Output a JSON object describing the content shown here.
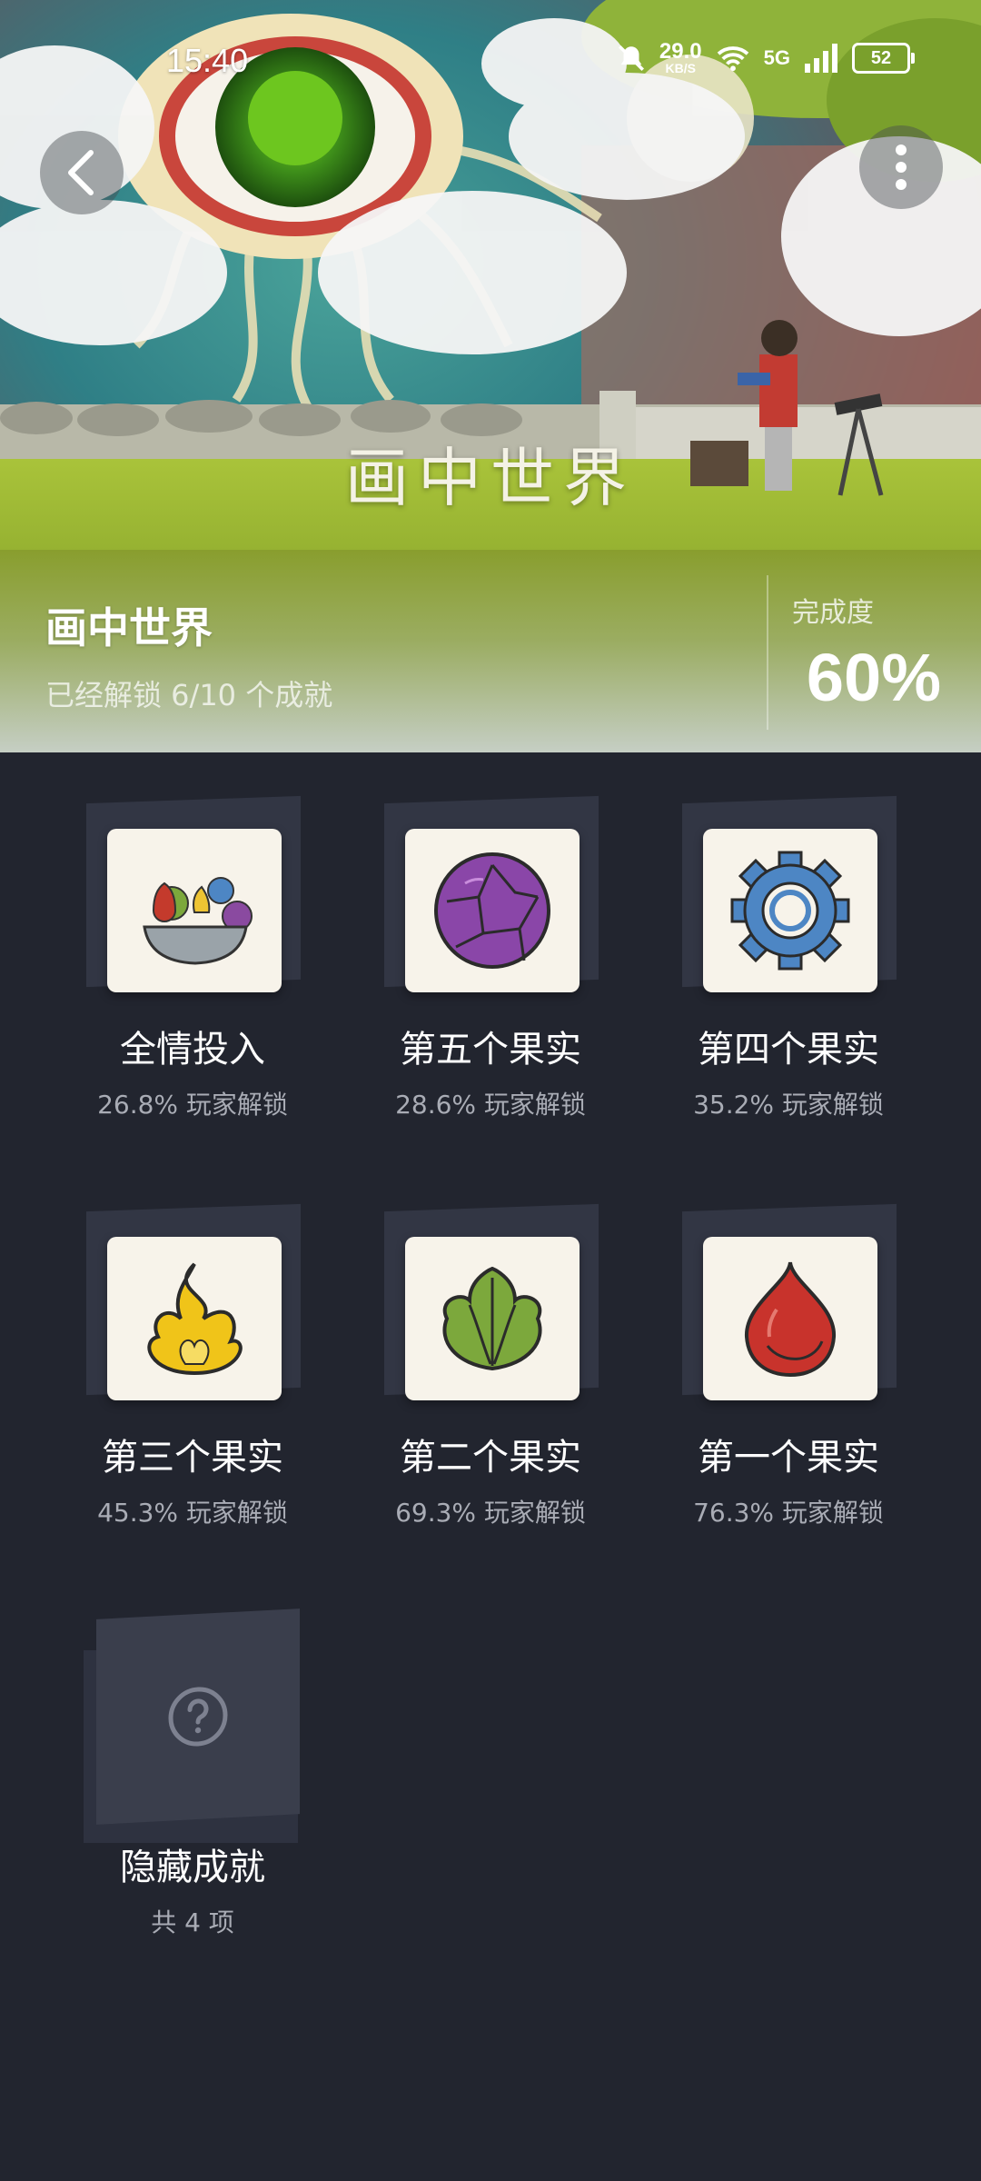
{
  "status_bar": {
    "time": "15:40",
    "speed_value": "29.0",
    "speed_unit": "KB/S",
    "network": "5G",
    "battery": "52"
  },
  "hero": {
    "art_title": "画中世界",
    "back_icon": "chevron-left-icon",
    "more_icon": "more-vertical-icon"
  },
  "game": {
    "name": "画中世界",
    "unlock_summary": "已经解锁 6/10 个成就",
    "completion_label": "完成度",
    "completion_value": "60%",
    "completion_fraction": 0.6
  },
  "achievements": [
    {
      "name": "全情投入",
      "percent": "26.8% 玩家解锁",
      "icon": "fruit-bowl-icon"
    },
    {
      "name": "第五个果实",
      "percent": "28.6% 玩家解锁",
      "icon": "purple-cracked-fruit-icon"
    },
    {
      "name": "第四个果实",
      "percent": "35.2% 玩家解锁",
      "icon": "blue-gear-fruit-icon"
    },
    {
      "name": "第三个果实",
      "percent": "45.3% 玩家解锁",
      "icon": "yellow-flame-fruit-icon"
    },
    {
      "name": "第二个果实",
      "percent": "69.3% 玩家解锁",
      "icon": "green-leaf-fruit-icon"
    },
    {
      "name": "第一个果实",
      "percent": "76.3% 玩家解锁",
      "icon": "red-drop-fruit-icon"
    }
  ],
  "hidden": {
    "name": "隐藏成就",
    "count": "共 4 项",
    "icon": "question-circle-icon"
  },
  "colors": {
    "background": "#22252f",
    "card_back": "#323644",
    "card_front": "#f7f3ea",
    "subtext": "#a9acb5"
  }
}
